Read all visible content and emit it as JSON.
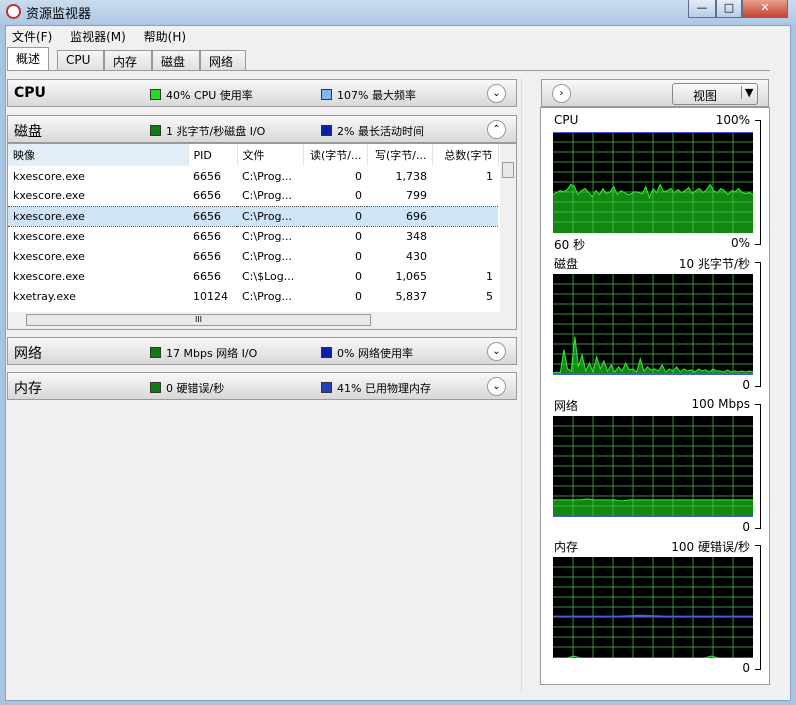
{
  "window": {
    "title": "资源监视器",
    "minimize": "—",
    "maximize": "□",
    "close": "✕"
  },
  "menu": [
    "文件(F)",
    "监视器(M)",
    "帮助(H)"
  ],
  "tabs": [
    "概述",
    "CPU",
    "内存",
    "磁盘",
    "网络"
  ],
  "sections": {
    "cpu": {
      "title": "CPU",
      "m1": "40% CPU 使用率",
      "m2": "107% 最大频率",
      "c1": "#2bd62b",
      "c2": "#7fb8f0"
    },
    "disk": {
      "title": "磁盘",
      "m1": "1 兆字节/秒磁盘 I/O",
      "m2": "2% 最长活动时间",
      "c1": "#117a11",
      "c2": "#0a1fa8"
    },
    "net": {
      "title": "网络",
      "m1": "17 Mbps 网络 I/O",
      "m2": "0% 网络使用率",
      "c1": "#117a11",
      "c2": "#0a1fa8"
    },
    "mem": {
      "title": "内存",
      "m1": "0 硬错误/秒",
      "m2": "41% 已用物理内存",
      "c1": "#117a11",
      "c2": "#2040c0"
    }
  },
  "disk_table": {
    "columns": [
      "映像",
      "PID",
      "文件",
      "读(字节/...",
      "写(字节/...",
      "总数(字节"
    ],
    "rows": [
      [
        "kxescore.exe",
        "6656",
        "C:\\Prog...",
        "0",
        "1,738",
        "1"
      ],
      [
        "kxescore.exe",
        "6656",
        "C:\\Prog...",
        "0",
        "799",
        ""
      ],
      [
        "kxescore.exe",
        "6656",
        "C:\\Prog...",
        "0",
        "696",
        ""
      ],
      [
        "kxescore.exe",
        "6656",
        "C:\\Prog...",
        "0",
        "348",
        ""
      ],
      [
        "kxescore.exe",
        "6656",
        "C:\\Prog...",
        "0",
        "430",
        ""
      ],
      [
        "kxescore.exe",
        "6656",
        "C:\\$Log...",
        "0",
        "1,065",
        "1"
      ],
      [
        "kxetray.exe",
        "10124",
        "C:\\Prog...",
        "0",
        "5,837",
        "5"
      ]
    ],
    "selected_row": 2,
    "hscroll_thumb": "III"
  },
  "right": {
    "view_button": "视图",
    "graphs": [
      {
        "name": "CPU",
        "max": "100%",
        "min": "0%",
        "time": "60 秒",
        "green": [
          38,
          40,
          42,
          41,
          43,
          48,
          46,
          38,
          42,
          44,
          40,
          36,
          42,
          38,
          44,
          39,
          41,
          46,
          38,
          42,
          40,
          38,
          39,
          41,
          40,
          39,
          46,
          35,
          44,
          40,
          48,
          41,
          42,
          44,
          40,
          43,
          40,
          42,
          45,
          39,
          42,
          44,
          40,
          43,
          48,
          42,
          40,
          44,
          42,
          38,
          42,
          41,
          44,
          40,
          39,
          40,
          38
        ],
        "blue": [
          100,
          100
        ]
      },
      {
        "name": "磁盘",
        "max": "10 兆字节/秒",
        "min": "0",
        "green": [
          2,
          3,
          2,
          25,
          6,
          4,
          38,
          8,
          20,
          4,
          12,
          3,
          18,
          6,
          14,
          4,
          10,
          3,
          8,
          4,
          12,
          5,
          6,
          3,
          16,
          4,
          8,
          5,
          6,
          4,
          10,
          3,
          6,
          4,
          8,
          3,
          6,
          4,
          5,
          3,
          6,
          4,
          5,
          3,
          6,
          4,
          4,
          3,
          5,
          3,
          4,
          3,
          4,
          3,
          4,
          3
        ],
        "blue": [
          1,
          1
        ]
      },
      {
        "name": "网络",
        "max": "100 Mbps",
        "min": "0",
        "green": [
          17,
          17,
          17,
          17,
          17,
          18,
          17,
          17,
          17,
          17,
          16,
          17,
          17,
          17,
          17,
          17,
          17,
          17,
          17,
          17,
          17,
          17,
          17,
          17,
          17,
          17,
          17,
          17,
          17,
          17
        ],
        "blue": [
          0,
          0
        ]
      },
      {
        "name": "内存",
        "max": "100 硬错误/秒",
        "min": "0",
        "green": [
          0,
          0,
          0,
          2,
          0,
          0,
          0,
          0,
          0,
          0,
          0,
          0,
          0,
          0,
          0,
          0,
          0,
          0,
          0,
          0,
          0,
          0,
          0,
          2,
          0,
          0,
          0,
          0,
          0,
          0
        ],
        "blue": [
          41,
          41,
          41,
          41,
          42,
          41,
          41,
          41,
          41,
          41
        ]
      }
    ]
  }
}
